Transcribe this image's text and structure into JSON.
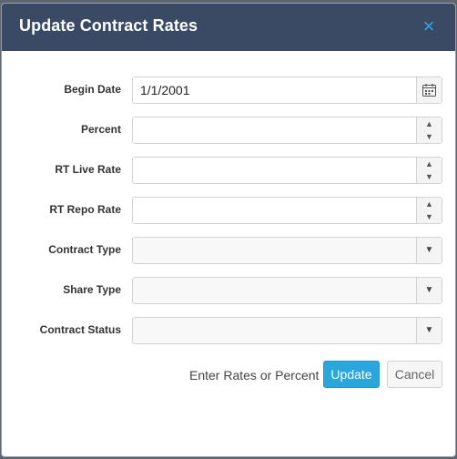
{
  "dialog": {
    "title": "Update Contract Rates",
    "close_icon": "close-icon",
    "close_glyph": "×"
  },
  "form": {
    "begin_date": {
      "label": "Begin Date",
      "value": "1/1/2001",
      "icon": "calendar-icon"
    },
    "percent": {
      "label": "Percent",
      "value": ""
    },
    "rt_live_rate": {
      "label": "RT Live Rate",
      "value": ""
    },
    "rt_repo_rate": {
      "label": "RT Repo Rate",
      "value": ""
    },
    "contract_type": {
      "label": "Contract Type",
      "value": ""
    },
    "share_type": {
      "label": "Share Type",
      "value": ""
    },
    "contract_status": {
      "label": "Contract Status",
      "value": ""
    }
  },
  "glyphs": {
    "spin_up": "▲",
    "spin_down": "▼",
    "caret": "▼"
  },
  "footer": {
    "message": "Enter Rates or Percent",
    "update_label": "Update",
    "cancel_label": "Cancel"
  },
  "colors": {
    "titlebar": "#3a4a64",
    "accent": "#2aa6dd"
  }
}
